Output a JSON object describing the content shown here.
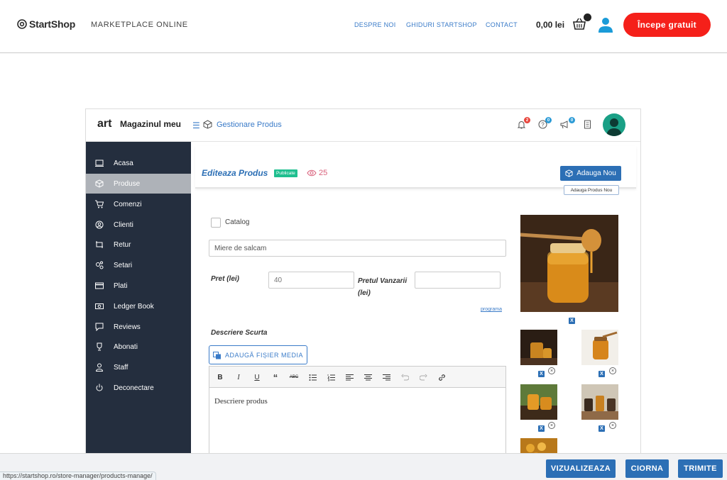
{
  "site": {
    "logo": "StartShop",
    "tagline": "MARKETPLACE ONLINE",
    "nav": [
      "DESPRE NOI",
      "GHIDURI STARTSHOP",
      "CONTACT"
    ],
    "price": "0,00 lei",
    "cta": "Începe gratuit"
  },
  "app": {
    "brand_short": "art",
    "brand": "Magazinul meu",
    "breadcrumb": "Gestionare Produs",
    "badges": {
      "notifications": "2",
      "help": "0",
      "announcements": "0"
    }
  },
  "sidebar": {
    "items": [
      {
        "label": "Acasa",
        "icon": "monitor-icon"
      },
      {
        "label": "Produse",
        "icon": "box-icon",
        "active": true
      },
      {
        "label": "Comenzi",
        "icon": "cart-icon"
      },
      {
        "label": "Clienti",
        "icon": "user-circle-icon"
      },
      {
        "label": "Retur",
        "icon": "return-icon"
      },
      {
        "label": "Setari",
        "icon": "gears-icon"
      },
      {
        "label": "Plati",
        "icon": "credit-card-icon"
      },
      {
        "label": "Ledger Book",
        "icon": "money-icon"
      },
      {
        "label": "Reviews",
        "icon": "comment-icon"
      },
      {
        "label": "Abonati",
        "icon": "trophy-icon"
      },
      {
        "label": "Staff",
        "icon": "user-icon"
      },
      {
        "label": "Deconectare",
        "icon": "power-icon"
      }
    ]
  },
  "editor": {
    "title": "Editeaza Produs",
    "status": "Publicate",
    "views": "25",
    "add_new": "Adauga Nou",
    "add_new_tooltip": "Adauga Produs Nou",
    "catalog_label": "Catalog",
    "product_name": "Miere de salcam",
    "price_label": "Pret (lei)",
    "price_value": "40",
    "sale_price_label": "Pretul Vanzarii (lei)",
    "sale_price_value": "",
    "schedule_link": "programa",
    "short_desc_label": "Descriere Scurta",
    "media_button": "ADAUGĂ FIȘIER MEDIA",
    "body_placeholder": "Descriere produs",
    "image_remove": "X"
  },
  "actions": {
    "preview": "VIZUALIZEAZA",
    "draft": "CIORNA",
    "submit": "TRIMITE"
  },
  "status_url": "https://startshop.ro/store-manager/products-manage/",
  "colors": {
    "accent": "#2c6fb5",
    "cta": "#f5201a",
    "sidebar": "#242e3e",
    "published": "#1fbf8f"
  }
}
